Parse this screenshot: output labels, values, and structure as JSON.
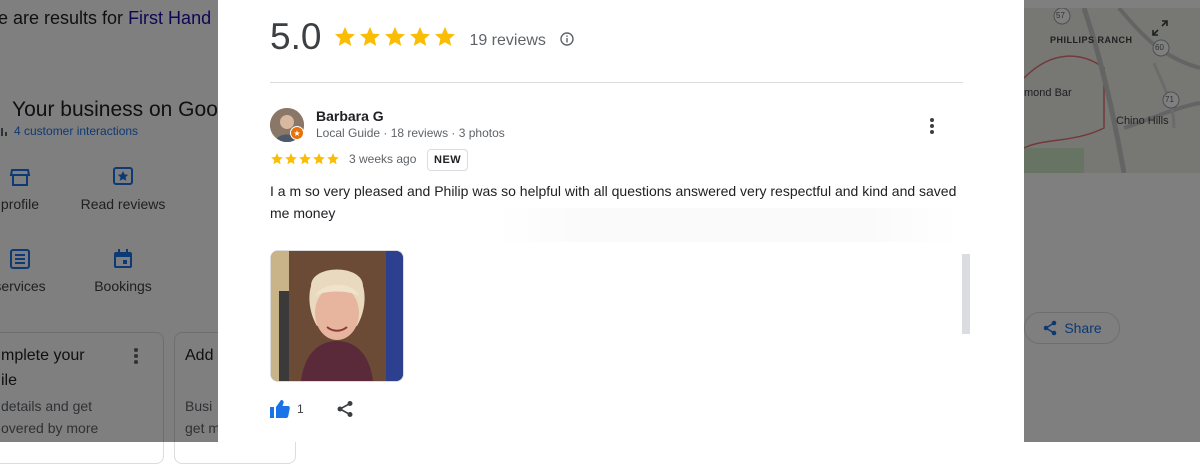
{
  "background": {
    "results_prefix": "e are results for ",
    "results_link": "First Hand",
    "business_title": "Your business on Goog",
    "interactions": "4 customer interactions",
    "actions": [
      {
        "label": "profile",
        "icon": "store-icon"
      },
      {
        "label": "Read reviews",
        "icon": "star-review-icon"
      },
      {
        "label": "services",
        "icon": "list-icon"
      },
      {
        "label": "Bookings",
        "icon": "calendar-icon"
      }
    ],
    "card1": {
      "title_line1": "mplete your",
      "title_line2": "ile",
      "text_line1": "details and get",
      "text_line2": "overed by more"
    },
    "card2": {
      "title": "Add",
      "text_line1": "Busi",
      "text_line2": "get m"
    },
    "map": {
      "labels": [
        "PHILLIPS RANCH",
        "mond Bar",
        "Chino Hills"
      ],
      "routes": [
        "57",
        "60",
        "71"
      ]
    },
    "share_label": "Share"
  },
  "modal": {
    "rating": "5.0",
    "review_count": "19 reviews",
    "review": {
      "name": "Barbara G",
      "meta": "Local Guide · 18 reviews · 3 photos",
      "stars": 5,
      "time": "3 weeks ago",
      "badge": "NEW",
      "text": "I a m so very pleased and Philip was so helpful with all questions answered very respectful and kind and saved me money",
      "likes": "1"
    }
  },
  "colors": {
    "star": "#fbbc04",
    "link": "#1a0dab",
    "accent": "#1a73e8",
    "badge": "#e8710a"
  }
}
